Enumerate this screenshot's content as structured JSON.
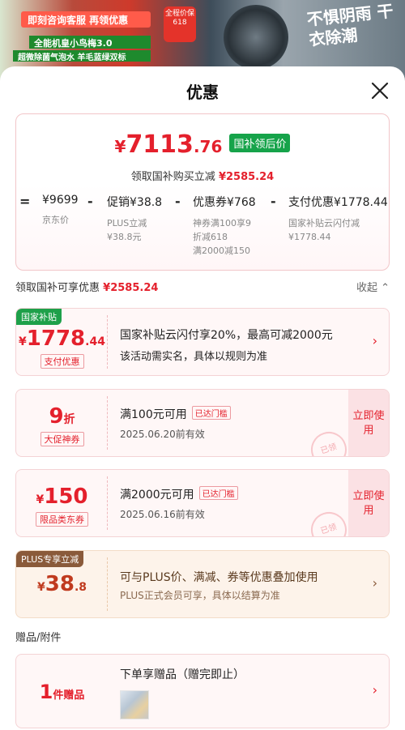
{
  "banner": {
    "line1": "即刻咨询客服 再领优惠",
    "line2": "全能机皇小鸟梅3.0",
    "line3": "超微除菌气泡水 羊毛蓝绿双标",
    "badge": "全程价保 618",
    "slogan": "不惧阴雨 干衣除潮"
  },
  "sheet": {
    "title": "优惠"
  },
  "summary": {
    "currency": "¥",
    "price_int": "7113",
    "price_dec": ".76",
    "price_tag": "国补领后价",
    "sub_text": "领取国补购买立减",
    "sub_amount": "¥2585.24",
    "breakdown": [
      {
        "op": "=",
        "value": "¥9699",
        "labels": [
          "京东价"
        ]
      },
      {
        "op": "-",
        "value": "促销¥38.8",
        "labels": [
          "PLUS立减",
          "¥38.8元"
        ]
      },
      {
        "op": "-",
        "value": "优惠券¥768",
        "labels": [
          "神券满100享9",
          "折减618",
          "满2000减150"
        ]
      },
      {
        "op": "-",
        "value": "支付优惠¥1778.44",
        "labels": [
          "国家补贴云闪付减",
          "¥1778.44"
        ]
      }
    ]
  },
  "section": {
    "label": "领取国补可享优惠",
    "amount": "¥2585.24",
    "collapse": "收起"
  },
  "coupons": [
    {
      "badge": "国家补贴",
      "badge_color": "#1ea04a",
      "cur": "¥",
      "amount": "1778",
      "amount_dec": ".44",
      "chip": "支付优惠",
      "desc": "国家补贴云闪付享20%，最高可减2000元",
      "meta": "该活动需实名，具体以规则为准"
    },
    {
      "amount": "9",
      "amount_suffix": "折",
      "chip": "大促神券",
      "desc": "满100元可用",
      "reach": "已达门槛",
      "meta": "2025.06.20前有效",
      "use": "立即使用",
      "stamp": "已领"
    },
    {
      "cur": "¥",
      "amount": "150",
      "chip": "限品类东券",
      "desc": "满2000元可用",
      "reach": "已达门槛",
      "meta": "2025.06.16前有效",
      "use": "立即使用",
      "stamp": "已领"
    },
    {
      "badge": "PLUS专享立减",
      "badge_color": "#8a5a3a",
      "cur": "¥",
      "amount": "38",
      "amount_dec": ".8",
      "desc": "可与PLUS价、满减、券等优惠叠加使用",
      "meta": "PLUS正式会员可享，具体以结算为准"
    }
  ],
  "gift": {
    "head": "赠品/附件",
    "count": "1",
    "count_unit": "件赠品",
    "desc": "下单享赠品（赠完即止）"
  },
  "icons": {
    "close": "close-icon",
    "chevron_right": "chevron-right-icon",
    "chevron_up": "chevron-up-icon"
  }
}
